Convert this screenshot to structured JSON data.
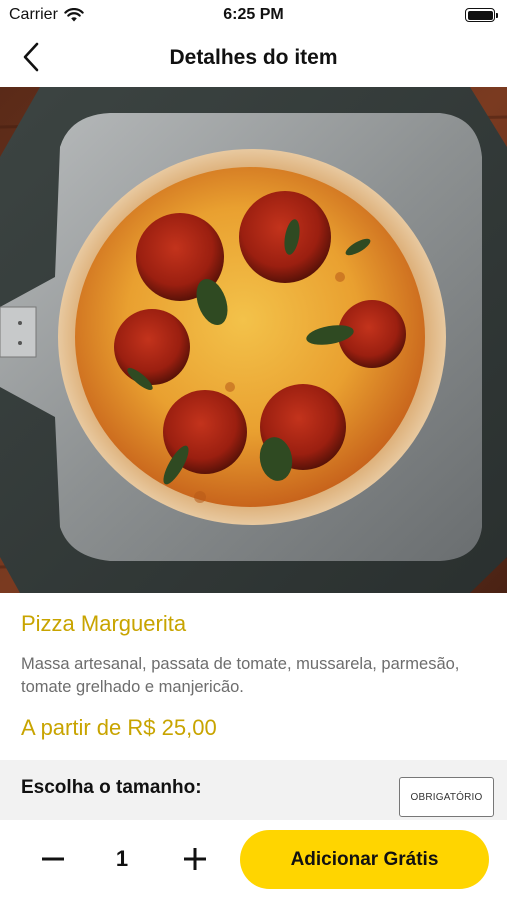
{
  "status_bar": {
    "carrier": "Carrier",
    "time": "6:25 PM"
  },
  "nav": {
    "title": "Detalhes do item",
    "back_icon": "chevron-left-icon"
  },
  "product": {
    "name": "Pizza Marguerita",
    "description": "Massa artesanal, passata de tomate, mussarela, parmesão, tomate grelhado e manjericão.",
    "price": "A partir de R$ 25,00",
    "image": "pizza-margherita-photo"
  },
  "section": {
    "title": "Escolha o tamanho:",
    "badge": "OBRIGATÓRIO"
  },
  "order": {
    "quantity": "1",
    "add_label": "Adicionar Grátis"
  },
  "colors": {
    "accent_text": "#c8a400",
    "button": "#ffd500",
    "section_bg": "#f2f2f2"
  }
}
